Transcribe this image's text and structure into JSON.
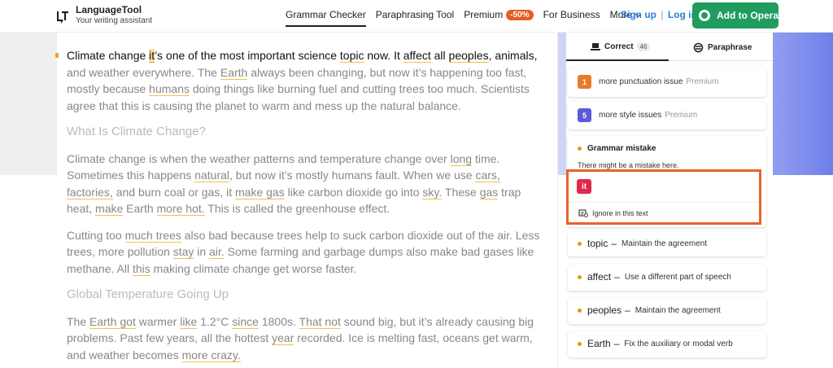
{
  "brand": {
    "title": "LanguageTool",
    "subtitle": "Your writing assistant"
  },
  "nav": {
    "items": [
      "Grammar Checker",
      "Paraphrasing Tool",
      "Premium"
    ],
    "sale_badge": "-50%",
    "business": "For Business",
    "more": "More"
  },
  "auth": {
    "signup": "Sign up",
    "separator": "|",
    "login": "Log in"
  },
  "cta": {
    "label": "Add to Opera"
  },
  "colors": {
    "accent_green": "#1f9c5e",
    "highlight_red": "#e0284e",
    "box_orange": "#e8632a",
    "link_blue": "#2d7fd3"
  },
  "editor": {
    "p1": {
      "a": "Climate change ",
      "b": "it",
      "c": "’s one of the most important science ",
      "d": "topic",
      "e": " now. It ",
      "f": "affect",
      "g": " all ",
      "h": "peoples",
      "i": ", animals,",
      "j": " and weather everywhere. The ",
      "k": "Earth",
      "l": " always been changing, but now it’s happening too fast, mostly because ",
      "m": "humans",
      "n": " doing things like burning fuel and cutting trees too much. Scientists agree that this is causing the planet to warm and mess up the natural balance."
    },
    "h1": "What Is Climate Change?",
    "p2": {
      "a": "Climate change is when the weather patterns and temperature change over ",
      "b": "long",
      "c": " time. Sometimes this happens ",
      "d": "natural",
      "e": ", but now it’s mostly humans fault. When we use ",
      "f": "cars, factories,",
      "g": " and burn coal or gas, it ",
      "h": "make gas",
      "i": " like carbon dioxide go into ",
      "j": "sky.",
      "k": " These ",
      "l": "gas",
      "m": " trap heat, ",
      "n": "make",
      "o": " Earth ",
      "p": "more hot.",
      "q": " This is called the greenhouse effect."
    },
    "p3": {
      "a": "Cutting too ",
      "b": "much trees",
      "c": " also bad because trees help to suck carbon dioxide out of the air. Less trees, more pollution ",
      "d": "stay",
      "e": " in ",
      "f": "air.",
      "g": " Some farming and garbage dumps also make bad gases like methane. All ",
      "h": "this",
      "i": " making climate change get worse faster."
    },
    "h2": "Global Temperature Going Up",
    "p4": {
      "a": "The ",
      "b": "Earth got",
      "c": " warmer ",
      "d": "like",
      "e": " 1.2°C ",
      "f": "since",
      "g": " 1800s. ",
      "h": "That not",
      "i": " sound big, but it’s already causing big problems. Past few years, all the hottest ",
      "j": "year",
      "k": " recorded. Ice is melting fast, oceans get warm, and weather becomes ",
      "l": "more crazy."
    }
  },
  "sidebar": {
    "tabs": {
      "correct": "Correct",
      "correct_count": "46",
      "paraphrase": "Paraphrase"
    },
    "cards": [
      {
        "num": "1",
        "text": "more punctuation issue",
        "premium": "Premium",
        "color": "#e57b2b"
      },
      {
        "num": "5",
        "text": "more style issues",
        "premium": "Premium",
        "color": "#5b5bd8"
      }
    ],
    "grammar": {
      "title": "Grammar mistake",
      "description": "There might be a mistake here.",
      "word": "it",
      "ignore": "Ignore in this text"
    },
    "suggestions": [
      {
        "word": "topic",
        "dash": "–",
        "text": "Maintain the agreement"
      },
      {
        "word": "affect",
        "dash": "–",
        "text": "Use a different part of speech"
      },
      {
        "word": "peoples",
        "dash": "–",
        "text": "Maintain the agreement"
      },
      {
        "word": "Earth",
        "dash": "–",
        "text": "Fix the auxiliary or modal verb"
      }
    ]
  }
}
